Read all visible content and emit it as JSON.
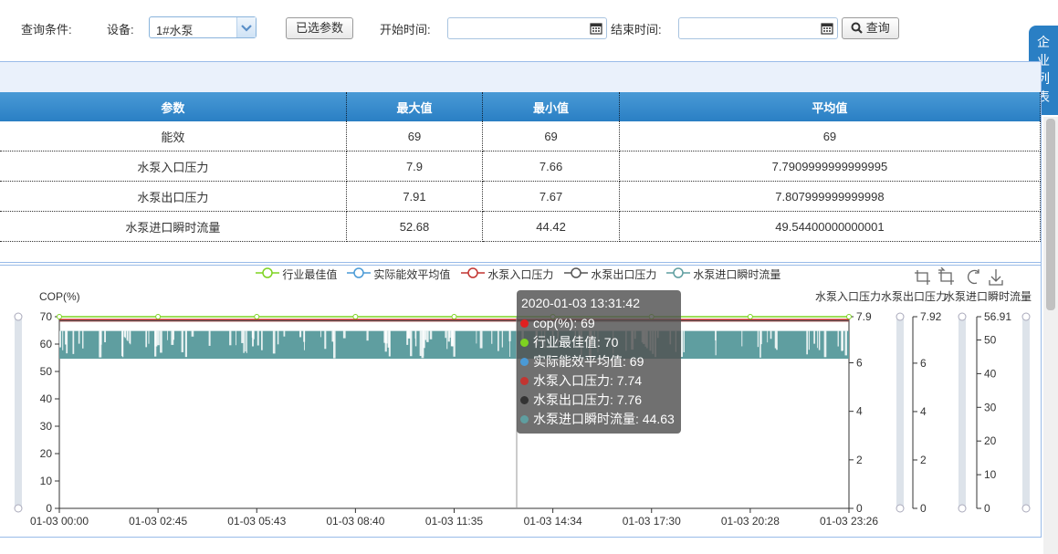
{
  "query": {
    "label": "查询条件:",
    "device_label": "设备:",
    "device_value": "1#水泵",
    "selected_params_button": "已选参数",
    "start_label": "开始时间:",
    "start_value": "",
    "end_label": "结束时间:",
    "end_value": "",
    "search_button": "查询"
  },
  "side_tab": {
    "label": "企业列表",
    "chars": [
      "企",
      "业",
      "列",
      "表"
    ]
  },
  "stats_table": {
    "headers": [
      "参数",
      "最大值",
      "最小值",
      "平均值"
    ],
    "rows": [
      [
        "能效",
        "69",
        "69",
        "69"
      ],
      [
        "水泵入口压力",
        "7.9",
        "7.66",
        "7.7909999999999995"
      ],
      [
        "水泵出口压力",
        "7.91",
        "7.67",
        "7.807999999999998"
      ],
      [
        "水泵进口瞬时流量",
        "52.68",
        "44.42",
        "49.54400000000001"
      ]
    ]
  },
  "chart_data": {
    "type": "line",
    "legend": [
      "行业最佳值",
      "实际能效平均值",
      "水泵入口压力",
      "水泵出口压力",
      "水泵进口瞬时流量"
    ],
    "legend_colors": [
      "#7ed321",
      "#4a9ad6",
      "#c23531",
      "#555555",
      "#5f9ea0"
    ],
    "x_tick_labels": [
      "01-03 00:00",
      "01-03 02:45",
      "01-03 05:43",
      "01-03 08:40",
      "01-03 11:35",
      "01-03 14:34",
      "01-03 17:30",
      "01-03 20:28",
      "01-03 23:26"
    ],
    "y_axes": [
      {
        "name": "COP(%)",
        "ticks": [
          0,
          10,
          20,
          30,
          40,
          50,
          60,
          70
        ],
        "ylim": [
          0,
          70
        ]
      },
      {
        "name": "水泵入口压力",
        "ticks": [
          0,
          2,
          4,
          6,
          7.9
        ],
        "ylim": [
          0,
          7.9
        ]
      },
      {
        "name": "水泵出口压力",
        "ticks": [
          0,
          2,
          4,
          6,
          7.92
        ],
        "ylim": [
          0,
          7.92
        ]
      },
      {
        "name": "水泵进口瞬时流量",
        "ticks": [
          0,
          10,
          20,
          30,
          40,
          50,
          56.91
        ],
        "ylim": [
          0,
          56.91
        ]
      }
    ],
    "series": [
      {
        "name": "cop(%)",
        "color": "#e02020",
        "level": 69
      },
      {
        "name": "行业最佳值",
        "color": "#7ed321",
        "level": 70
      },
      {
        "name": "实际能效平均值",
        "color": "#4a9ad6",
        "level": 69
      },
      {
        "name": "水泵入口压力",
        "color": "#c23531",
        "level": 7.74
      },
      {
        "name": "水泵出口压力",
        "color": "#555555",
        "level": 7.76
      },
      {
        "name": "水泵进口瞬时流量",
        "color": "#5f9ea0",
        "level": 44.63,
        "band": [
          44.42,
          52.68
        ]
      }
    ],
    "grid": false
  },
  "tooltip": {
    "time": "2020-01-03 13:31:42",
    "rows": [
      {
        "label": "cop(%): 69",
        "color": "#e02020"
      },
      {
        "label": "行业最佳值: 70",
        "color": "#7ed321"
      },
      {
        "label": "实际能效平均值: 69",
        "color": "#4a9ad6"
      },
      {
        "label": "水泵入口压力: 7.74",
        "color": "#c23531"
      },
      {
        "label": "水泵出口压力: 7.76",
        "color": "#333333"
      },
      {
        "label": "水泵进口瞬时流量: 44.63",
        "color": "#5f9ea0"
      }
    ]
  },
  "toolbox": [
    "zoom-icon",
    "zoom-reset-icon",
    "restore-icon",
    "download-icon"
  ]
}
